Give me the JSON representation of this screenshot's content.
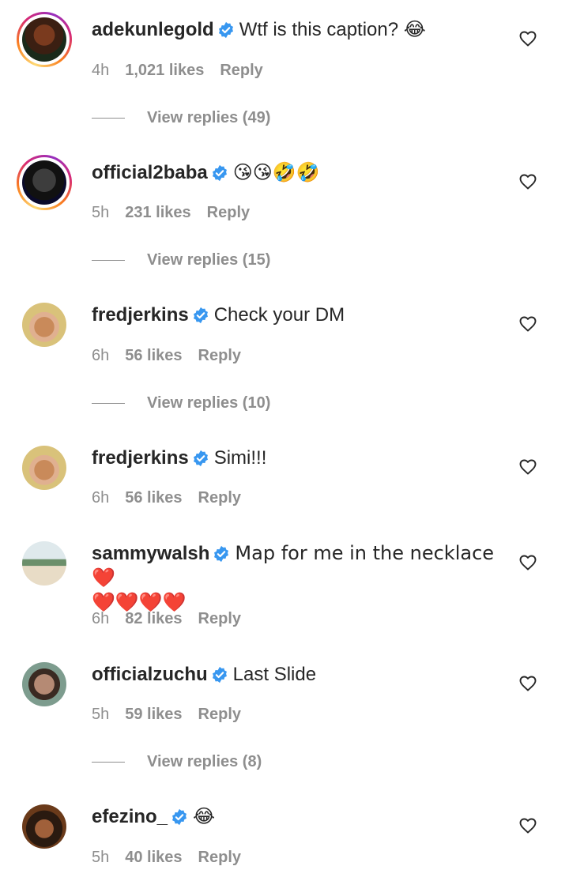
{
  "comments": [
    {
      "username": "adekunlegold",
      "text": "Wtf is this caption? 😂",
      "time": "4h",
      "likes": "1,021 likes",
      "reply": "Reply",
      "view_replies": "View replies (49)"
    },
    {
      "username": "official2baba",
      "text": "😘😘🤣🤣",
      "time": "5h",
      "likes": "231 likes",
      "reply": "Reply",
      "view_replies": "View replies (15)"
    },
    {
      "username": "fredjerkins",
      "text": "Check your DM",
      "time": "6h",
      "likes": "56 likes",
      "reply": "Reply",
      "view_replies": "View replies (10)"
    },
    {
      "username": "fredjerkins",
      "text": "Simi!!!",
      "time": "6h",
      "likes": "56 likes",
      "reply": "Reply"
    },
    {
      "username": "sammywalsh",
      "text": "Map for me in the necklace ❤️",
      "text2": "❤️❤️❤️❤️",
      "time": "6h",
      "likes": "82 likes",
      "reply": "Reply"
    },
    {
      "username": "officialzuchu",
      "text": "Last Slide",
      "time": "5h",
      "likes": "59 likes",
      "reply": "Reply",
      "view_replies": "View replies (8)"
    },
    {
      "username": "efezino_",
      "text": "😂",
      "time": "5h",
      "likes": "40 likes",
      "reply": "Reply"
    }
  ],
  "colors": {
    "verified": "#3897f0",
    "muted": "#8e8e8e",
    "text": "#262626"
  },
  "icons": {
    "verified": "verified-badge-icon",
    "like": "heart-outline-icon"
  }
}
